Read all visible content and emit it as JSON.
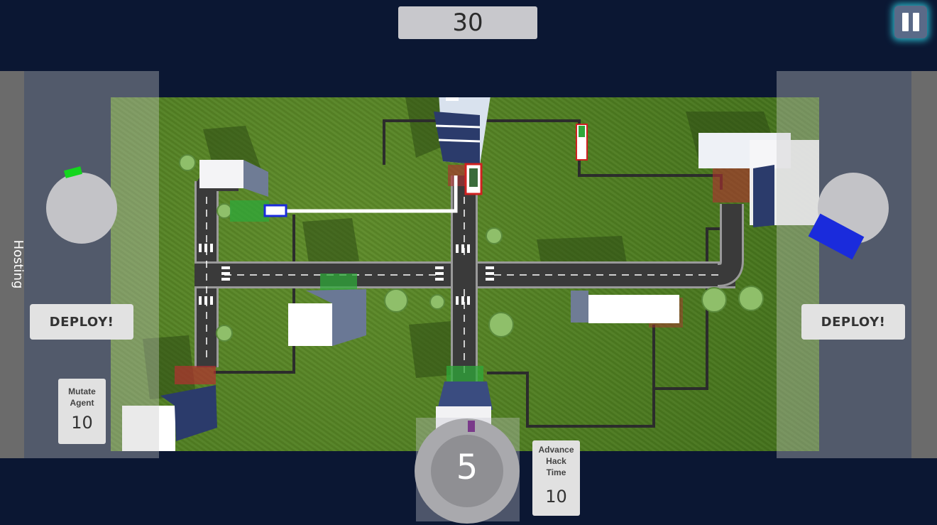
{
  "hud": {
    "timer": "30",
    "countdown": "5",
    "pause_icon": "pause-icon"
  },
  "left_panel": {
    "title": "Hosting",
    "deploy_label": "DEPLOY!",
    "mutate_card": {
      "label_line1": "Mutate",
      "label_line2": "Agent",
      "cost": "10"
    }
  },
  "right_panel": {
    "deploy_label": "DEPLOY!"
  },
  "bottom": {
    "advance_card": {
      "label_line1": "Advance",
      "label_line2": "Hack",
      "label_line3": "Time",
      "cost": "10"
    }
  },
  "colors": {
    "background": "#0b1733",
    "grass": "#4f7d22",
    "road": "#333333",
    "infected_zone": "#b33030",
    "safe_zone": "#2fa83a",
    "player_agent": "#14d61e",
    "enemy_agent": "#1a2bdc",
    "pause_glow": "#2bb6c9"
  }
}
